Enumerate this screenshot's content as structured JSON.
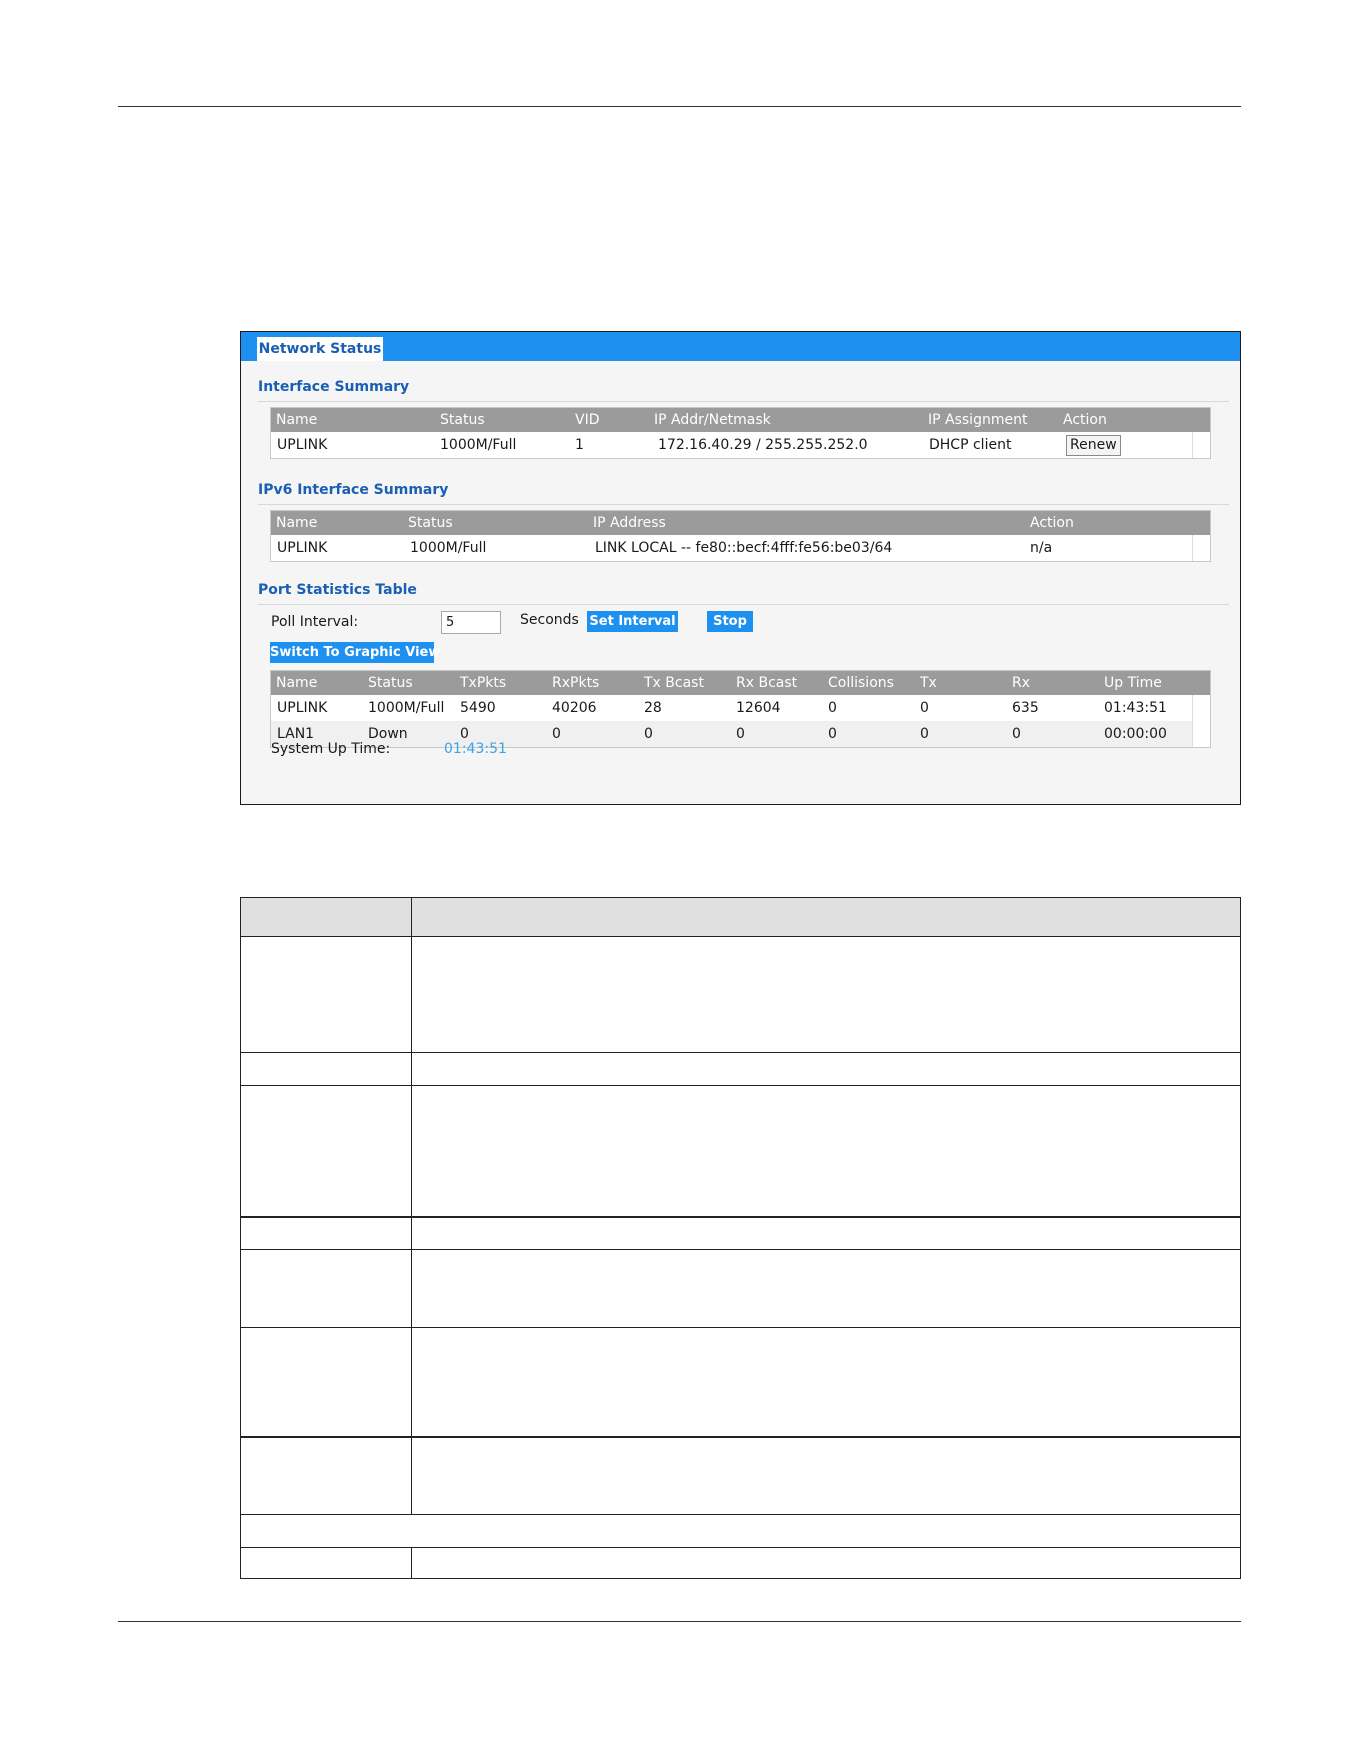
{
  "panel": {
    "tab_label": "Network Status",
    "interface_summary": {
      "title": "Interface Summary",
      "columns": [
        "Name",
        "Status",
        "VID",
        "IP Addr/Netmask",
        "IP Assignment",
        "Action"
      ],
      "rows": [
        {
          "name": "UPLINK",
          "status": "1000M/Full",
          "vid": "1",
          "ip": "172.16.40.29 / 255.255.252.0",
          "assignment": "DHCP client",
          "action": "Renew"
        }
      ]
    },
    "ipv6_summary": {
      "title": "IPv6 Interface Summary",
      "columns": [
        "Name",
        "Status",
        "IP Address",
        "Action"
      ],
      "rows": [
        {
          "name": "UPLINK",
          "status": "1000M/Full",
          "ip": "LINK LOCAL -- fe80::becf:4fff:fe56:be03/64",
          "action": "n/a"
        }
      ]
    },
    "port_stats": {
      "title": "Port Statistics Table",
      "poll_label": "Poll Interval:",
      "poll_value": "5",
      "seconds_label": "Seconds",
      "set_interval_label": "Set Interval",
      "stop_label": "Stop",
      "switch_label": "Switch To Graphic View",
      "columns": [
        "Name",
        "Status",
        "TxPkts",
        "RxPkts",
        "Tx Bcast",
        "Rx Bcast",
        "Collisions",
        "Tx",
        "Rx",
        "Up Time"
      ],
      "rows": [
        [
          "UPLINK",
          "1000M/Full",
          "5490",
          "40206",
          "28",
          "12604",
          "0",
          "0",
          "635",
          "01:43:51"
        ],
        [
          "LAN1",
          "Down",
          "0",
          "0",
          "0",
          "0",
          "0",
          "0",
          "0",
          "00:00:00"
        ]
      ],
      "system_up_label": "System Up Time:",
      "system_up_value": "01:43:51"
    }
  }
}
